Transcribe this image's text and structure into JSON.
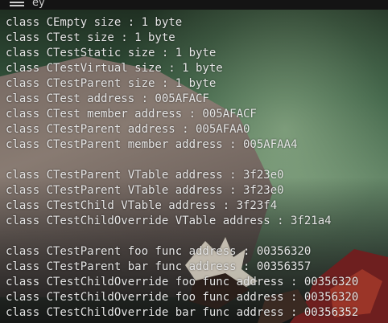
{
  "window": {
    "title_fragment": "ey"
  },
  "console": {
    "lines": [
      "class CEmpty size : 1 byte",
      "class CTest size : 1 byte",
      "class CTestStatic size : 1 byte",
      "class CTestVirtual size : 1 byte",
      "class CTestParent size : 1 byte",
      "class CTest address : 005AFACF",
      "class CTest member address : 005AFACF",
      "class CTestParent address : 005AFAA0",
      "class CTestParent member address : 005AFAA4",
      "",
      "class CTestParent VTable address : 3f23e0",
      "class CTestParent VTable address : 3f23e0",
      "class CTestChild VTable address : 3f23f4",
      "class CTestChildOverride VTable address : 3f21a4",
      "",
      "class CTestParent foo func address : 00356320",
      "class CTestParent bar func address : 00356357",
      "class CTestChildOverride foo func address : 00356320",
      "class CTestChildOverride foo func address : 00356320",
      "class CTestChildOverride bar func address : 00356352"
    ]
  },
  "icons": {
    "menu": "hamburger-menu-icon"
  }
}
